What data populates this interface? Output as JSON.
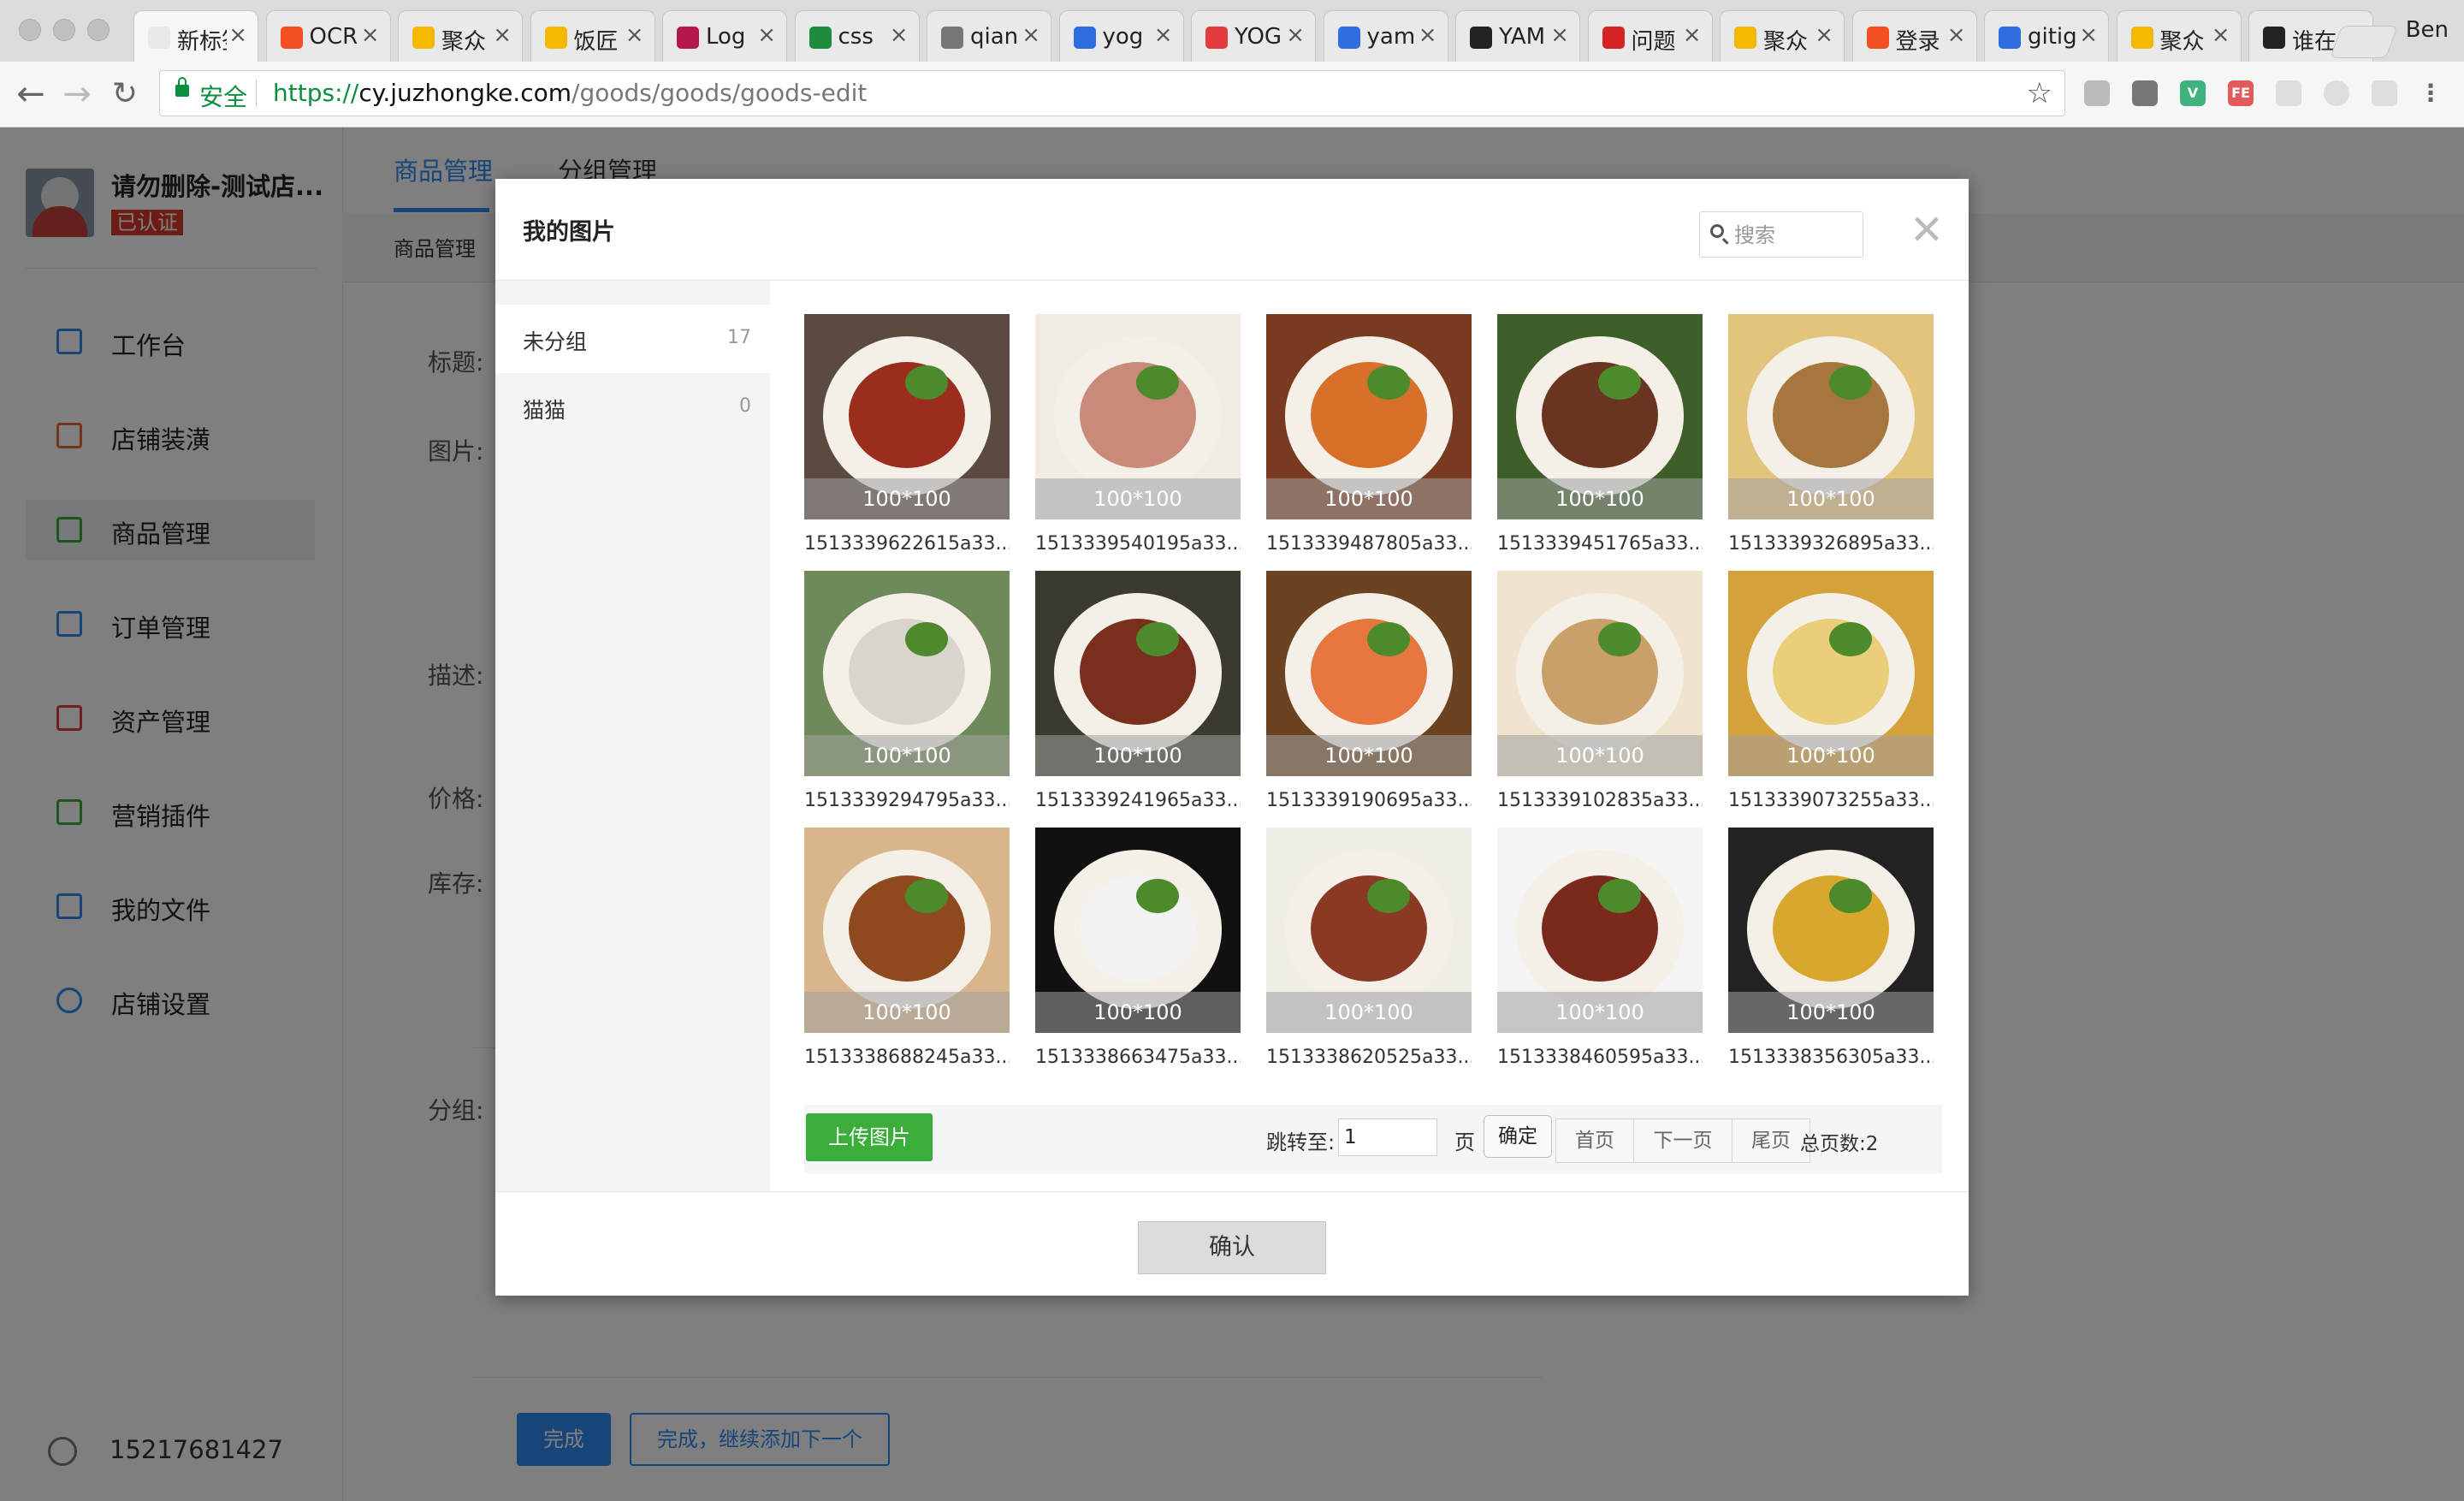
{
  "browser": {
    "tabs": [
      {
        "title": "新标签页",
        "icon": "blank-page-icon",
        "color": "#e9e9e9"
      },
      {
        "title": "OCR",
        "icon": "windows-logo-icon",
        "color": "#f25022"
      },
      {
        "title": "聚众",
        "icon": "juzhong-logo-icon",
        "color": "#f5b700"
      },
      {
        "title": "饭匠",
        "icon": "juzhong-logo-icon",
        "color": "#f5b700"
      },
      {
        "title": "Log",
        "icon": "r-logo-icon",
        "color": "#b5174f"
      },
      {
        "title": "css",
        "icon": "sf-logo-icon",
        "color": "#1f8b3c"
      },
      {
        "title": "qian",
        "icon": "document-icon",
        "color": "#777777"
      },
      {
        "title": "yog",
        "icon": "baidu-paw-icon",
        "color": "#2f6de1"
      },
      {
        "title": "YOG",
        "icon": "fex-logo-icon",
        "color": "#e23c3c"
      },
      {
        "title": "yam",
        "icon": "baidu-paw-icon",
        "color": "#2f6de1"
      },
      {
        "title": "YAM",
        "icon": "feather-icon",
        "color": "#222222"
      },
      {
        "title": "问题",
        "icon": "sentry-logo-icon",
        "color": "#d42323"
      },
      {
        "title": "聚众",
        "icon": "juzhong-logo-icon",
        "color": "#f5b700"
      },
      {
        "title": "登录",
        "icon": "windows-logo-icon",
        "color": "#f25022"
      },
      {
        "title": "gitig",
        "icon": "baidu-paw-icon",
        "color": "#2f6de1"
      },
      {
        "title": "聚众",
        "icon": "juzhong-logo-icon",
        "color": "#f5b700"
      },
      {
        "title": "谁在",
        "icon": "github-logo-icon",
        "color": "#222222"
      }
    ],
    "close_glyph": "×",
    "profile": "Ben",
    "secure_label": "安全",
    "url_scheme": "https://",
    "url_host": "cy.juzhongke.com",
    "url_path": "/goods/goods/goods-edit"
  },
  "sidebar": {
    "store_name": "请勿删除-测试店...",
    "verified_badge": "已认证",
    "items": [
      {
        "label": "工作台",
        "icon": "monitor-icon"
      },
      {
        "label": "店铺装潢",
        "icon": "store-decor-icon"
      },
      {
        "label": "商品管理",
        "icon": "bag-icon"
      },
      {
        "label": "订单管理",
        "icon": "list-icon"
      },
      {
        "label": "资产管理",
        "icon": "wallet-icon"
      },
      {
        "label": "营销插件",
        "icon": "grid-icon"
      },
      {
        "label": "我的文件",
        "icon": "folder-icon"
      },
      {
        "label": "店铺设置",
        "icon": "gear-icon"
      }
    ],
    "active_index": 2,
    "user_phone": "15217681427"
  },
  "main": {
    "tabs": [
      "商品管理",
      "分组管理"
    ],
    "subnav": "商品管理",
    "form_labels": {
      "title": "标题:",
      "image": "图片:",
      "desc": "描述:",
      "price": "价格:",
      "stock": "库存:",
      "group": "分组:"
    },
    "done_button": "完成",
    "done_next_button": "完成，继续添加下一个"
  },
  "modal": {
    "title": "我的图片",
    "search_placeholder": "搜索",
    "close_glyph": "✕",
    "groups": [
      {
        "name": "未分组",
        "count": "17"
      },
      {
        "name": "猫猫",
        "count": "0"
      }
    ],
    "images": [
      {
        "name": "1513339622615a33...",
        "dims": "100*100",
        "bg": "#5a4a40",
        "food": "#9b2d1c"
      },
      {
        "name": "1513339540195a33...",
        "dims": "100*100",
        "bg": "#f2ece6",
        "food": "#c98a7a"
      },
      {
        "name": "1513339487805a33...",
        "dims": "100*100",
        "bg": "#7a3a1f",
        "food": "#d9702a"
      },
      {
        "name": "1513339451765a33...",
        "dims": "100*100",
        "bg": "#3f5f2a",
        "food": "#6a3520"
      },
      {
        "name": "1513339326895a33...",
        "dims": "100*100",
        "bg": "#e2c47c",
        "food": "#a7763f"
      },
      {
        "name": "1513339294795a33...",
        "dims": "100*100",
        "bg": "#6f8a5a",
        "food": "#d9d5cc"
      },
      {
        "name": "1513339241965a33...",
        "dims": "100*100",
        "bg": "#3a3a2e",
        "food": "#7a2e1e"
      },
      {
        "name": "1513339190695a33...",
        "dims": "100*100",
        "bg": "#6b4322",
        "food": "#e5773f"
      },
      {
        "name": "1513339102835a33...",
        "dims": "100*100",
        "bg": "#f0e4cf",
        "food": "#c9a06a"
      },
      {
        "name": "1513339073255a33...",
        "dims": "100*100",
        "bg": "#d4a13a",
        "food": "#e9cf7a"
      },
      {
        "name": "1513338688245a33...",
        "dims": "100*100",
        "bg": "#d8b58a",
        "food": "#8e4a1e"
      },
      {
        "name": "1513338663475a33...",
        "dims": "100*100",
        "bg": "#111111",
        "food": "#f2f2f2"
      },
      {
        "name": "1513338620525a33...",
        "dims": "100*100",
        "bg": "#f1eee8",
        "food": "#8a3a22"
      },
      {
        "name": "1513338460595a33...",
        "dims": "100*100",
        "bg": "#f4f4f4",
        "food": "#7a2a1c"
      },
      {
        "name": "1513338356305a33...",
        "dims": "100*100",
        "bg": "#222222",
        "food": "#d9a62e"
      }
    ],
    "upload_button": "上传图片",
    "jump_label": "跳转至:",
    "page_value": "1",
    "page_unit": "页",
    "go_button": "确定",
    "pager": {
      "first": "首页",
      "next": "下一页",
      "last": "尾页"
    },
    "total_pages": "总页数:2",
    "confirm_button": "确认"
  },
  "colors": {
    "accent": "#2f8af5",
    "upload_green": "#3aad3a",
    "verified_red": "#d9362a",
    "secure_green": "#0a8f3e"
  }
}
